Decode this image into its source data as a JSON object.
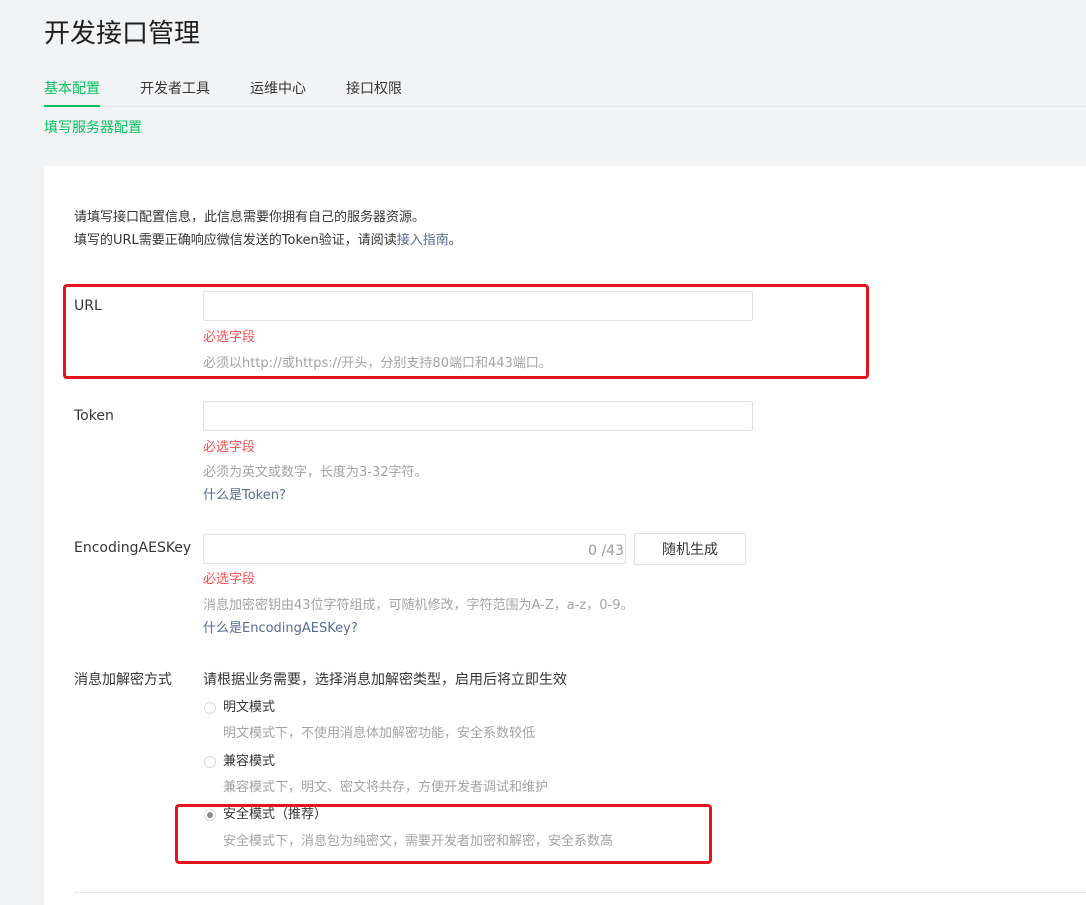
{
  "page": {
    "title": "开发接口管理"
  },
  "tabs": [
    {
      "label": "基本配置",
      "active": true
    },
    {
      "label": "开发者工具",
      "active": false
    },
    {
      "label": "运维中心",
      "active": false
    },
    {
      "label": "接口权限",
      "active": false
    }
  ],
  "section": {
    "link": "填写服务器配置"
  },
  "intro": {
    "line1": "请填写接口配置信息，此信息需要你拥有自己的服务器资源。",
    "line2_prefix": "填写的URL需要正确响应微信发送的Token验证，请阅读",
    "line2_link": "接入指南",
    "line2_suffix": "。"
  },
  "form": {
    "url": {
      "label": "URL",
      "value": "",
      "error": "必选字段",
      "hint": "必须以http://或https://开头，分别支持80端口和443端口。"
    },
    "token": {
      "label": "Token",
      "value": "",
      "error": "必选字段",
      "hint": "必须为英文或数字，长度为3-32字符。",
      "help": "什么是Token?"
    },
    "aeskey": {
      "label": "EncodingAESKey",
      "value": "",
      "counter": "0 /43",
      "button": "随机生成",
      "error": "必选字段",
      "hint": "消息加密密钥由43位字符组成，可随机修改，字符范围为A-Z，a-z，0-9。",
      "help": "什么是EncodingAESKey?"
    },
    "encryption": {
      "label": "消息加解密方式",
      "description": "请根据业务需要，选择消息加解密类型，启用后将立即生效",
      "selected": "安全模式（推荐）",
      "options": [
        {
          "label": "明文模式",
          "hint": "明文模式下，不使用消息体加解密功能，安全系数较低",
          "checked": false
        },
        {
          "label": "兼容模式",
          "hint": "兼容模式下，明文、密文将共存，方便开发者调试和维护",
          "checked": false
        },
        {
          "label": "安全模式（推荐）",
          "hint": "安全模式下，消息包为纯密文，需要开发者加密和解密，安全系数高",
          "checked": true
        }
      ]
    }
  },
  "colors": {
    "accent": "#07c160",
    "link": "#576b95",
    "error": "#fa5151",
    "highlight": "#e5141c"
  }
}
